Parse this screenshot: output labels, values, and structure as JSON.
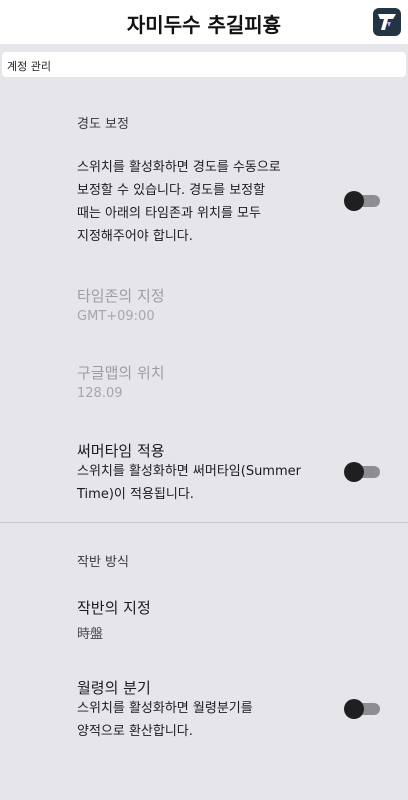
{
  "header": {
    "title": "자미두수 추길피흉",
    "logo_icon": "app-logo-icon"
  },
  "account": {
    "label": "계정 관리"
  },
  "longitude_section": {
    "heading": "경도 보정",
    "description": "스위치를 활성화하면 경도를 수동으로\n보정할 수 있습니다. 경도를 보정할\n때는 아래의 타임존과 위치를 모두\n지정해주어야 합니다.",
    "toggle_on": false,
    "timezone": {
      "title": "타임존의 지정",
      "value": "GMT+09:00"
    },
    "location": {
      "title": "구글맵의 위치",
      "value": "128.09"
    },
    "summer_time": {
      "title": "써머타임 적용",
      "description": "스위치를 활성화하면 써머타임(Summer\nTime)이 적용됩니다.",
      "toggle_on": false
    }
  },
  "chart_method_section": {
    "heading": "작반 방식",
    "chart_method": {
      "title": "작반의 지정",
      "value": "時盤"
    },
    "leap_month": {
      "title": "월령의 분기",
      "description": "스위치를 활성화하면 월령분기를\n양적으로 환산합니다.",
      "toggle_on": false
    }
  },
  "colors": {
    "background": "#e6e5ea",
    "toggle_thumb_off": "#1f1f22",
    "toggle_track_off": "#8e8d93",
    "disabled_text": "#9e9da3"
  }
}
